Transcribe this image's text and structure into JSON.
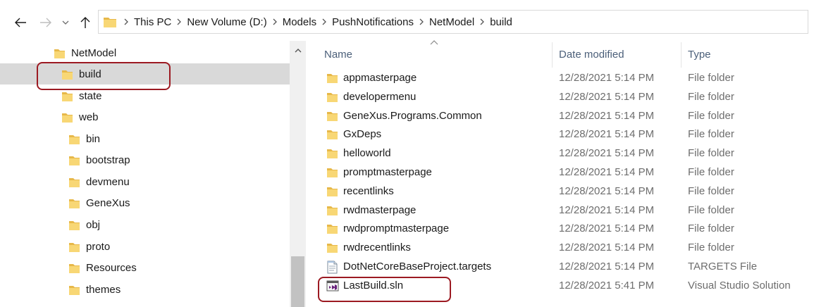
{
  "nav_buttons": {
    "back_icon": "arrow-left-icon",
    "forward_icon": "arrow-right-icon",
    "recent_icon": "chevron-down-icon",
    "up_icon": "arrow-up-icon"
  },
  "breadcrumb": [
    "This PC",
    "New Volume (D:)",
    "Models",
    "PushNotifications",
    "NetModel",
    "build"
  ],
  "nav_tree": [
    {
      "label": "NetModel",
      "selected": false,
      "highlighted": false
    },
    {
      "label": "build",
      "selected": true,
      "highlighted": true
    },
    {
      "label": "state",
      "selected": false,
      "highlighted": false
    },
    {
      "label": "web",
      "selected": false,
      "highlighted": false
    },
    {
      "label": "bin",
      "selected": false,
      "highlighted": false
    },
    {
      "label": "bootstrap",
      "selected": false,
      "highlighted": false
    },
    {
      "label": "devmenu",
      "selected": false,
      "highlighted": false
    },
    {
      "label": "GeneXus",
      "selected": false,
      "highlighted": false
    },
    {
      "label": "obj",
      "selected": false,
      "highlighted": false
    },
    {
      "label": "proto",
      "selected": false,
      "highlighted": false
    },
    {
      "label": "Resources",
      "selected": false,
      "highlighted": false
    },
    {
      "label": "themes",
      "selected": false,
      "highlighted": false
    }
  ],
  "columns": {
    "name": "Name",
    "date": "Date modified",
    "type": "Type"
  },
  "files": [
    {
      "name": "appmasterpage",
      "date": "12/28/2021 5:14 PM",
      "type": "File folder",
      "icon": "folder-icon",
      "highlighted": false
    },
    {
      "name": "developermenu",
      "date": "12/28/2021 5:14 PM",
      "type": "File folder",
      "icon": "folder-icon",
      "highlighted": false
    },
    {
      "name": "GeneXus.Programs.Common",
      "date": "12/28/2021 5:14 PM",
      "type": "File folder",
      "icon": "folder-icon",
      "highlighted": false
    },
    {
      "name": "GxDeps",
      "date": "12/28/2021 5:14 PM",
      "type": "File folder",
      "icon": "folder-icon",
      "highlighted": false
    },
    {
      "name": "helloworld",
      "date": "12/28/2021 5:14 PM",
      "type": "File folder",
      "icon": "folder-icon",
      "highlighted": false
    },
    {
      "name": "promptmasterpage",
      "date": "12/28/2021 5:14 PM",
      "type": "File folder",
      "icon": "folder-icon",
      "highlighted": false
    },
    {
      "name": "recentlinks",
      "date": "12/28/2021 5:14 PM",
      "type": "File folder",
      "icon": "folder-icon",
      "highlighted": false
    },
    {
      "name": "rwdmasterpage",
      "date": "12/28/2021 5:14 PM",
      "type": "File folder",
      "icon": "folder-icon",
      "highlighted": false
    },
    {
      "name": "rwdpromptmasterpage",
      "date": "12/28/2021 5:14 PM",
      "type": "File folder",
      "icon": "folder-icon",
      "highlighted": false
    },
    {
      "name": "rwdrecentlinks",
      "date": "12/28/2021 5:14 PM",
      "type": "File folder",
      "icon": "folder-icon",
      "highlighted": false
    },
    {
      "name": "DotNetCoreBaseProject.targets",
      "date": "12/28/2021 5:14 PM",
      "type": "TARGETS File",
      "icon": "text-file-icon",
      "highlighted": false
    },
    {
      "name": "LastBuild.sln",
      "date": "12/28/2021 5:41 PM",
      "type": "Visual Studio Solution",
      "icon": "visual-studio-solution-icon",
      "highlighted": true
    }
  ],
  "colors": {
    "folder": "#f8d775",
    "folder_dark": "#e7b849",
    "selection": "#d9d9d9",
    "highlight_border": "#9c1a22",
    "header_text": "#4c607a",
    "secondary_text": "#6d6d6d",
    "vs_purple": "#68217a"
  }
}
